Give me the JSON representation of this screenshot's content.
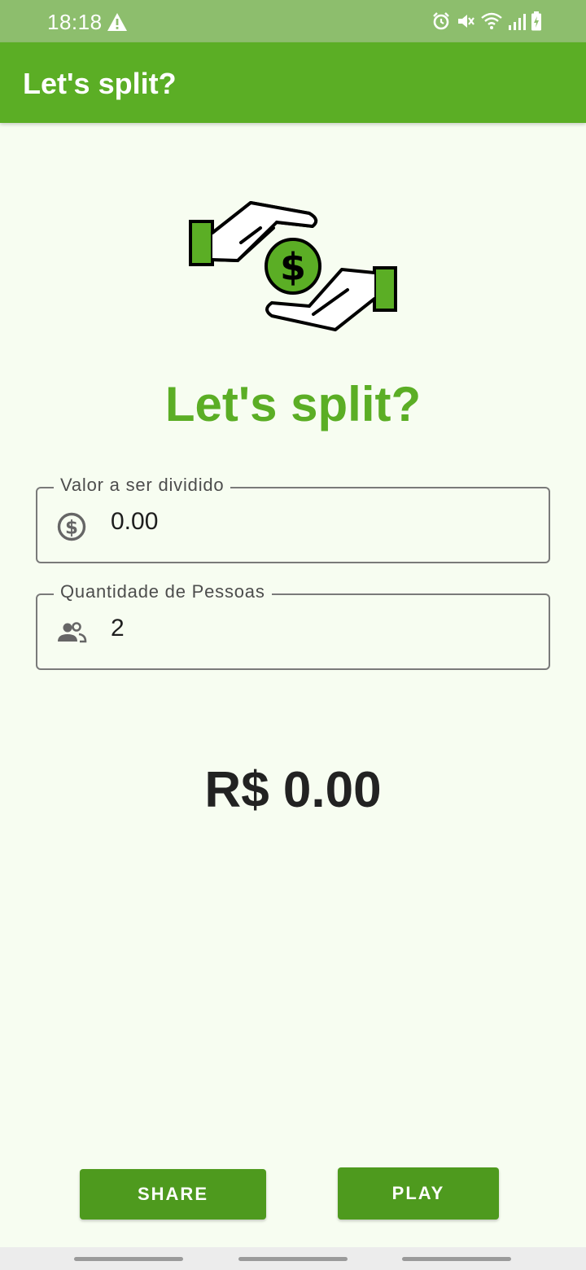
{
  "status_bar": {
    "time": "18:18",
    "icons": [
      "warning-icon",
      "alarm-icon",
      "mute-icon",
      "wifi-icon",
      "signal-icon",
      "battery-icon"
    ]
  },
  "app_bar": {
    "title": "Let's split?"
  },
  "hero": {
    "title": "Let's split?",
    "illustration": "hands-exchanging-coin"
  },
  "form": {
    "amount": {
      "label": "Valor a ser dividido",
      "value": "0.00",
      "icon": "dollar-circle-icon"
    },
    "people": {
      "label": "Quantidade de Pessoas",
      "value": "2",
      "icon": "people-icon"
    }
  },
  "result": {
    "text": "R$ 0.00"
  },
  "actions": {
    "share_label": "SHARE",
    "play_label": "PLAY"
  },
  "colors": {
    "primary": "#5BAE25",
    "button": "#4E9A1E",
    "status_bar": "#8DBE6D",
    "background": "#F7FDF1"
  }
}
